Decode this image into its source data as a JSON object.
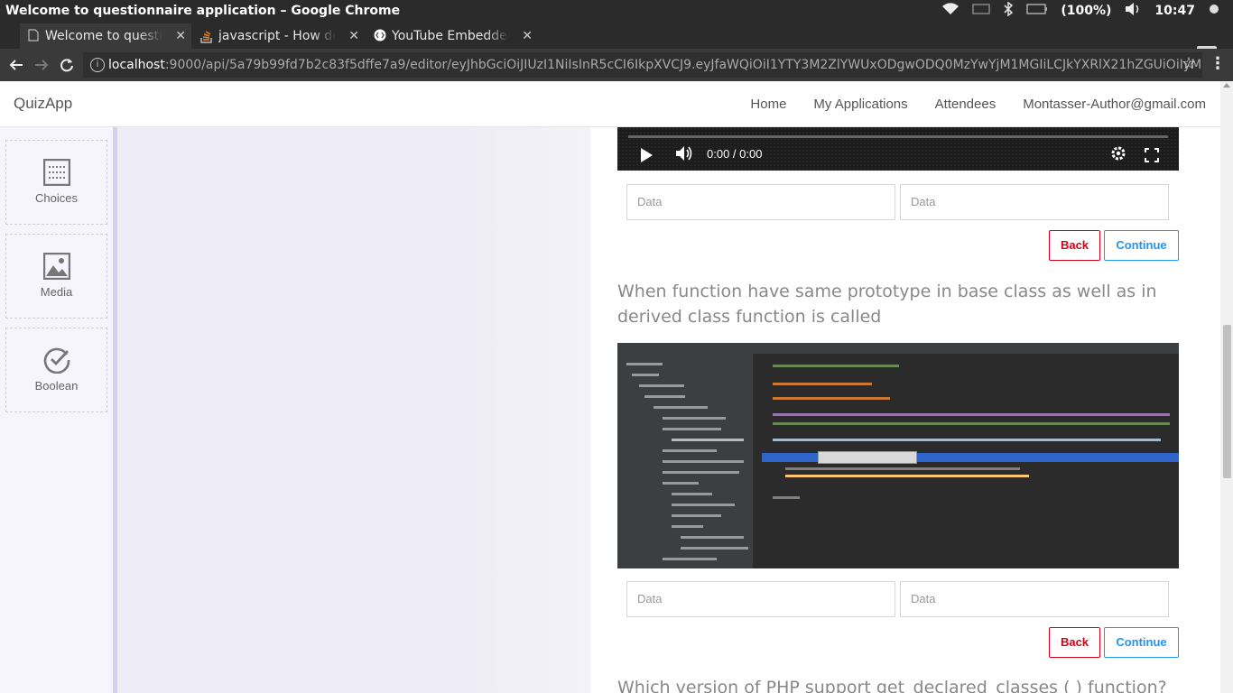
{
  "os": {
    "window_title": "Welcome to questionnaire application – Google Chrome",
    "battery": "(100%)",
    "clock": "10:47"
  },
  "tabs": [
    {
      "label": "Welcome to questionnaire application",
      "active": true
    },
    {
      "label": "javascript - How do I embed",
      "active": false
    },
    {
      "label": "YouTube Embedded Players",
      "active": false
    }
  ],
  "address_bar": {
    "host": "localhost",
    "rest": ":9000/api/5a79b99fd7b2c83f5dffe7a9/editor/eyJhbGciOiJIUzI1NiIsInR5cCI6IkpXVCJ9.eyJfaWQiOiI1YTY3M2ZlYWUxODgwODQ0MzYwYjM1MGIiLCJkYXRlX21hZGUiOiIyMDE4..."
  },
  "app": {
    "brand": "QuizApp",
    "nav": [
      "Home",
      "My Applications",
      "Attendees",
      "Montasser-Author@gmail.com"
    ]
  },
  "sidebar": {
    "tools": [
      {
        "label": "Choices",
        "icon": "choices-icon"
      },
      {
        "label": "Media",
        "icon": "image-icon"
      },
      {
        "label": "Boolean",
        "icon": "check-circle-icon"
      }
    ]
  },
  "video": {
    "time": "0:00 / 0:00"
  },
  "blocks": [
    {
      "field_a": "Data",
      "field_b": "Data",
      "back": "Back",
      "continue": "Continue"
    },
    {
      "question": "When function have same prototype in base class as well as in derived class function is called",
      "field_a": "Data",
      "field_b": "Data",
      "back": "Back",
      "continue": "Continue"
    }
  ],
  "next_question": "Which version of PHP support get_declared_classes ( ) function?"
}
